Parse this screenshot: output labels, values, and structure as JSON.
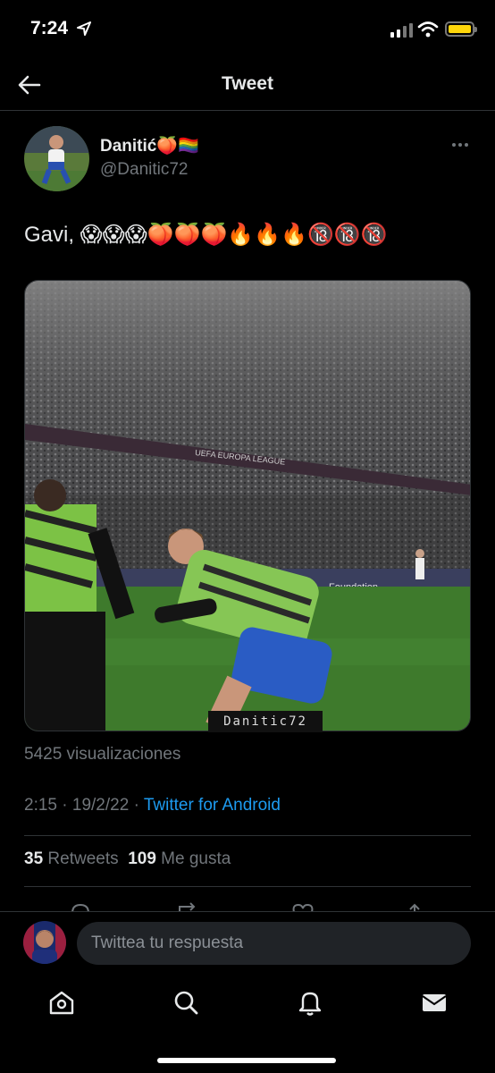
{
  "status_bar": {
    "time": "7:24"
  },
  "header": {
    "title": "Tweet"
  },
  "tweet": {
    "author_name": "Danitić🍑🏳️‍🌈",
    "author_handle": "@Danitic72",
    "text": "Gavi, 😱😱😱🍑🍑🍑🔥🔥🔥🔞🔞🔞",
    "media": {
      "watermark": "Danitic72",
      "board_text_1": "UEFA EUROPA LEAGUE",
      "board_text_2": "Foundation"
    },
    "views": "5425 visualizaciones",
    "time": "2:15",
    "date": "19/2/22",
    "separator": "·",
    "source": "Twitter for Android",
    "retweets_count": "35",
    "retweets_label": "Retweets",
    "likes_count": "109",
    "likes_label": "Me gusta"
  },
  "reply": {
    "placeholder": "Twittea tu respuesta"
  },
  "tabs": [
    "home-icon",
    "search-icon",
    "notifications-icon",
    "messages-icon"
  ],
  "colors": {
    "accent": "#1d9bf0",
    "background": "#000000",
    "battery": "#ffd60a"
  }
}
